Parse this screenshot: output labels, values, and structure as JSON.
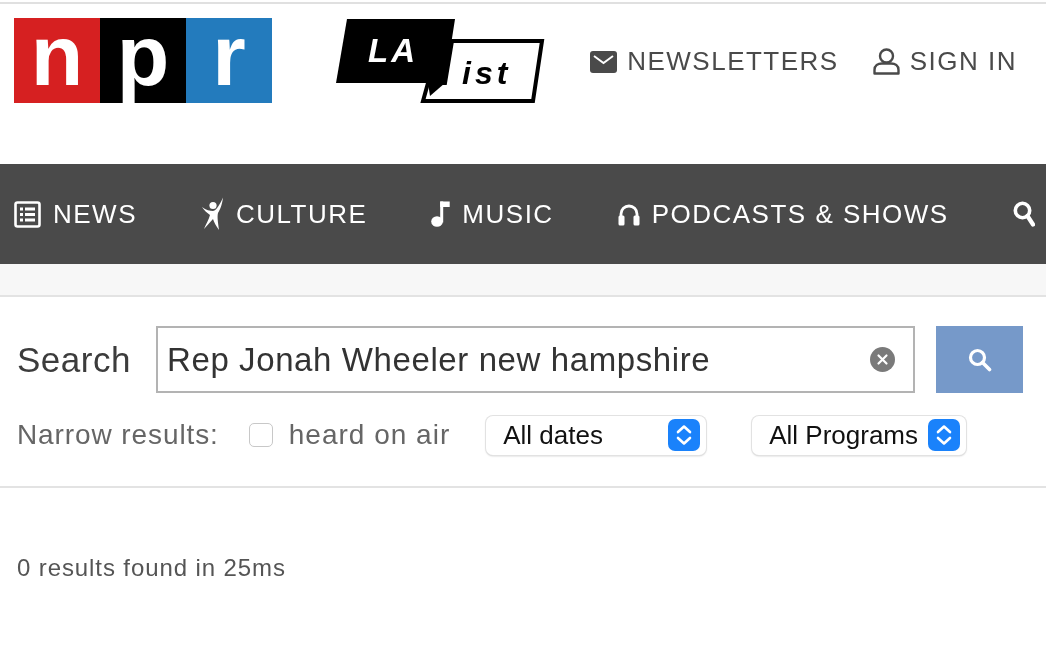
{
  "header": {
    "npr_logo": {
      "tiles": [
        {
          "letter": "n",
          "color": "#d62021"
        },
        {
          "letter": "p",
          "color": "#000000"
        },
        {
          "letter": "r",
          "color": "#237bbd"
        }
      ]
    },
    "laist_logo": {
      "top": "LA",
      "bottom": "ist"
    },
    "links": [
      {
        "label": "NEWSLETTERS"
      },
      {
        "label": "SIGN IN"
      }
    ]
  },
  "nav": {
    "items": [
      {
        "label": "NEWS"
      },
      {
        "label": "CULTURE"
      },
      {
        "label": "MUSIC"
      },
      {
        "label": "PODCASTS & SHOWS"
      }
    ]
  },
  "search": {
    "label": "Search",
    "value": "Rep Jonah Wheeler new hampshire"
  },
  "filters": {
    "label": "Narrow results:",
    "heard_on_air": {
      "label": "heard on air",
      "checked": false
    },
    "selects": [
      {
        "value": "All dates"
      },
      {
        "value": "All Programs"
      }
    ]
  },
  "results": {
    "summary": "0 results found in 25ms"
  }
}
